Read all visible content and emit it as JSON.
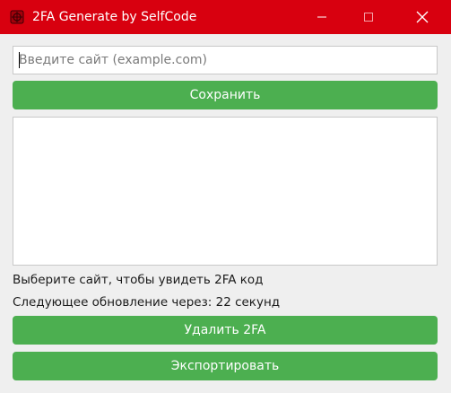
{
  "window": {
    "title": "2FA Generate by SelfCode",
    "titlebar_color": "#d8000f",
    "controls": [
      "minimize-icon",
      "maximize-icon",
      "close-icon"
    ]
  },
  "form": {
    "site_placeholder": "Введите сайт (example.com)",
    "site_value": "",
    "save_label": "Сохранить"
  },
  "site_list": {
    "items": []
  },
  "status": {
    "code_hint": "Выберите сайт, чтобы увидеть 2FA код",
    "timer_text": "Следующее обновление через: 22 секунд"
  },
  "actions": {
    "delete_label": "Удалить 2FA",
    "export_label": "Экспортировать",
    "button_color": "#4caf50"
  }
}
